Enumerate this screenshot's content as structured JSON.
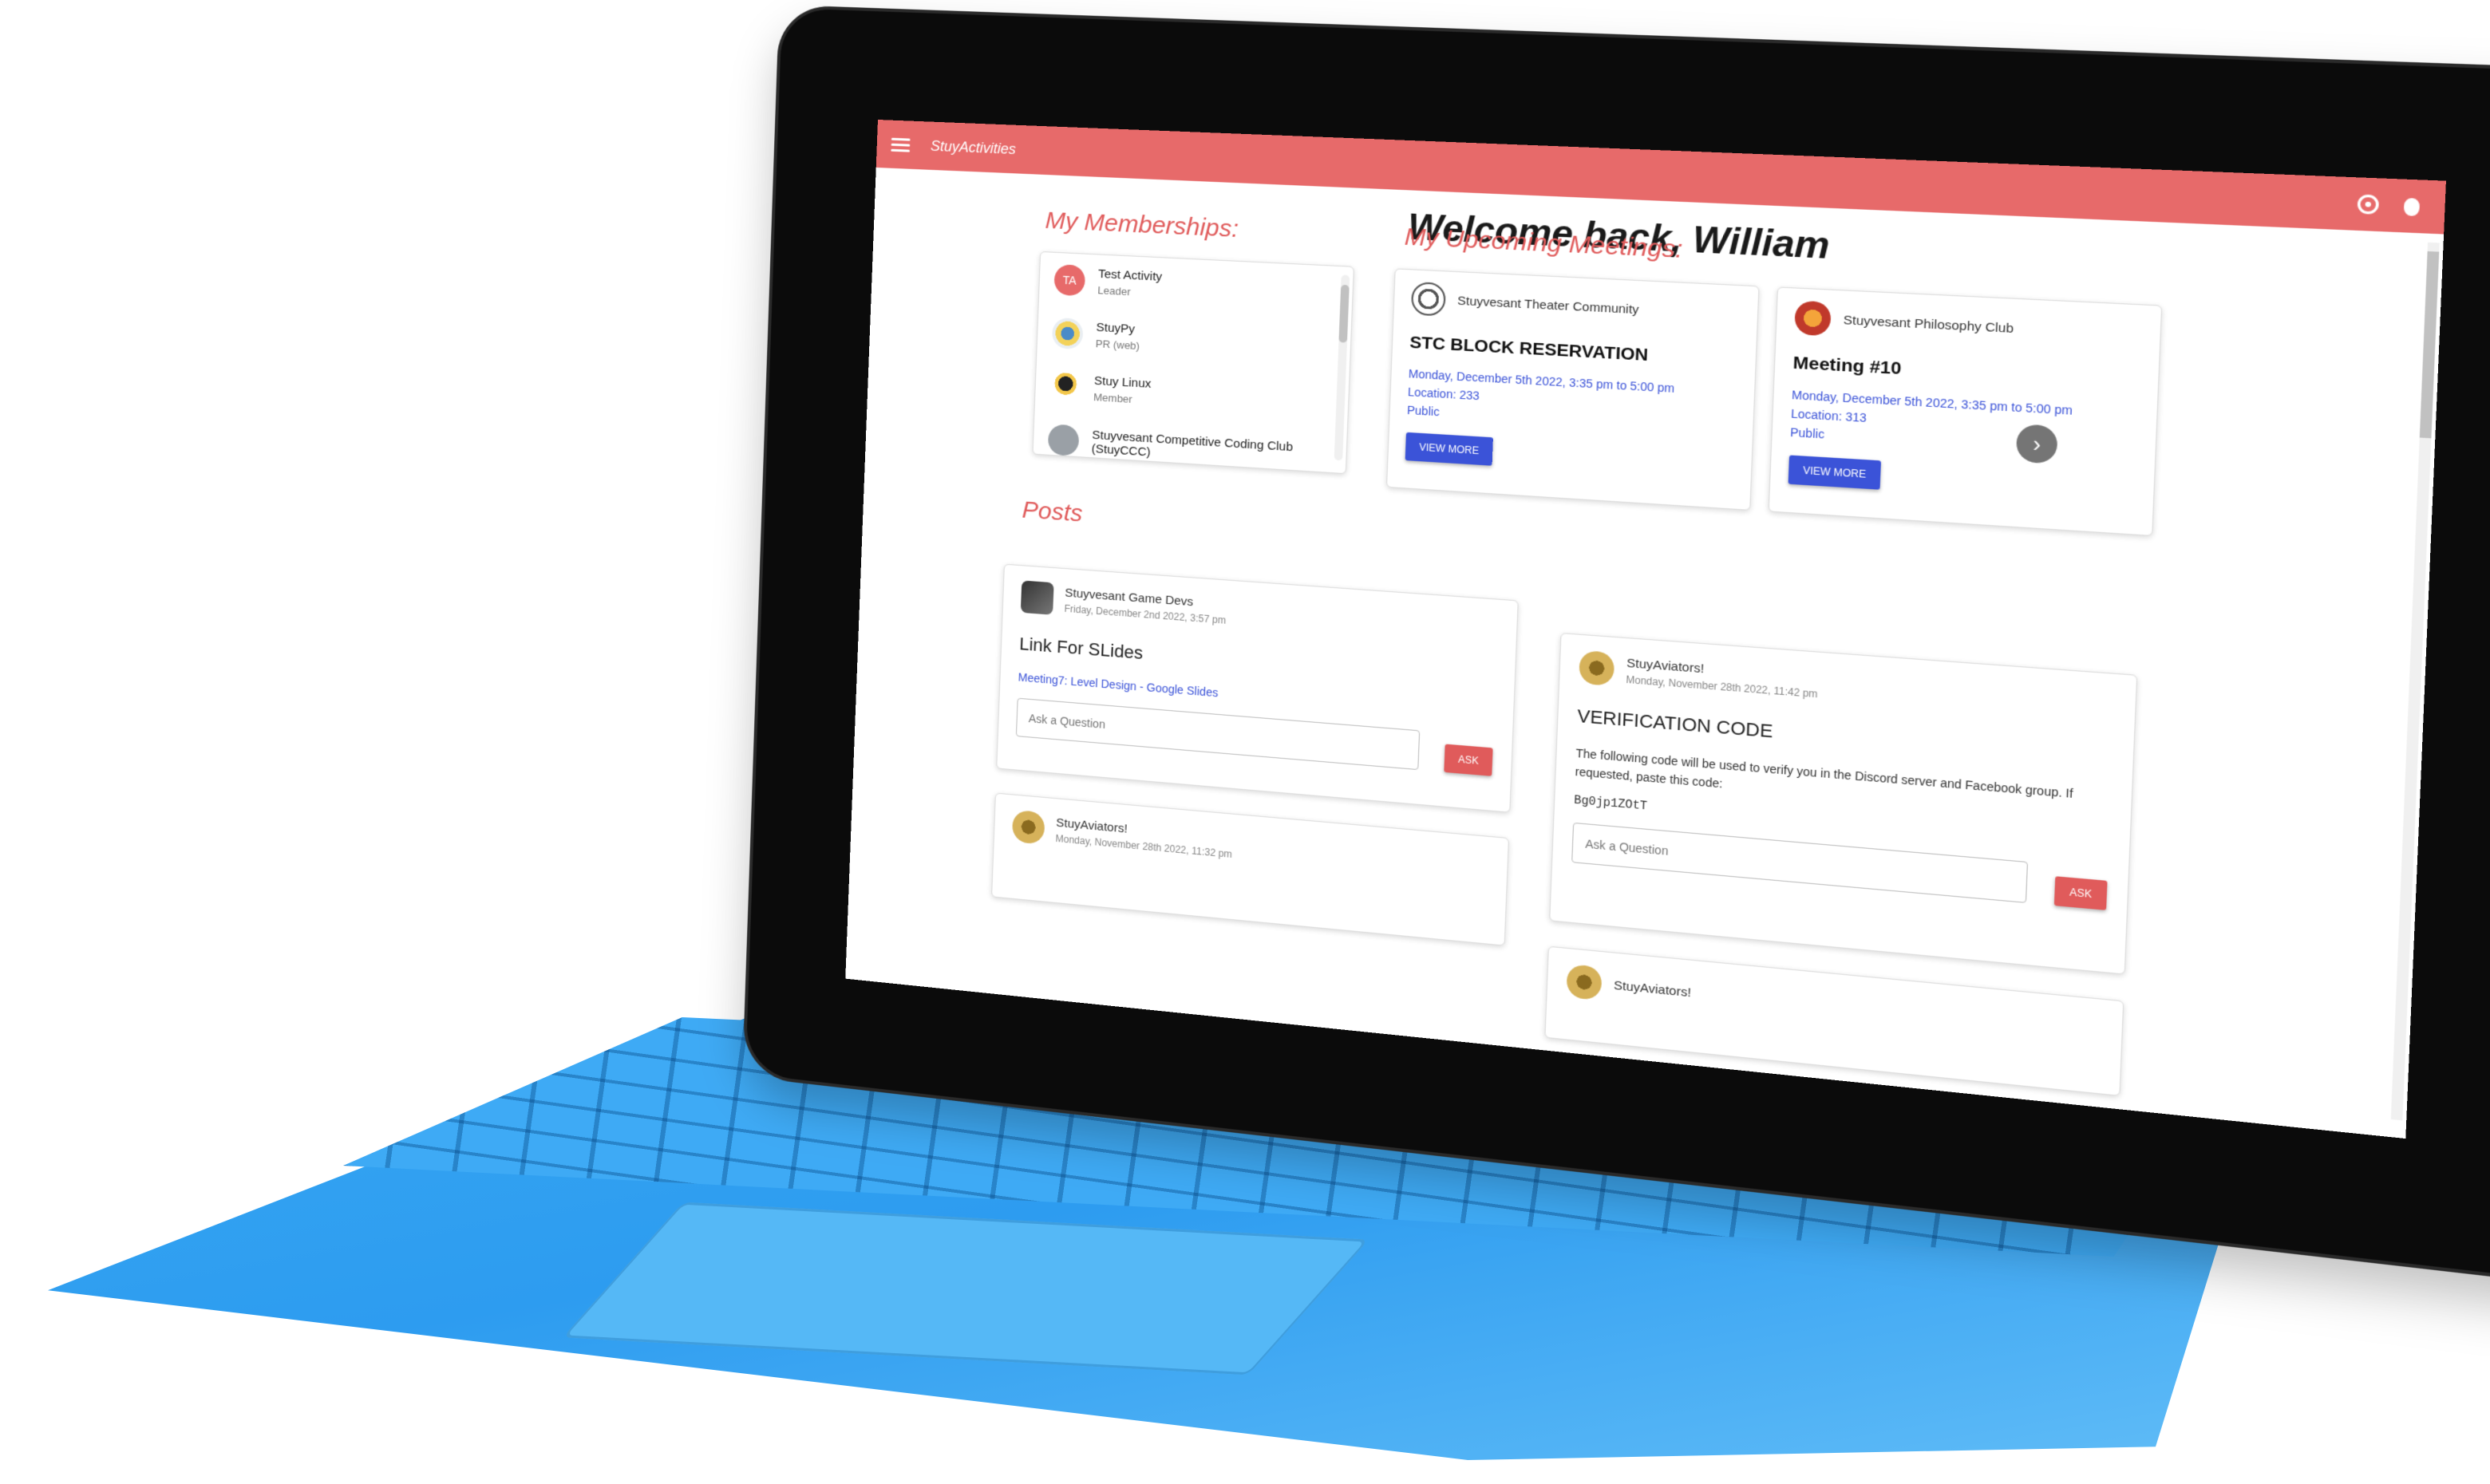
{
  "app": {
    "title": "StuyActivities"
  },
  "welcome": "Welcome back, William",
  "memberships": {
    "title": "My Memberships:",
    "items": [
      {
        "initials": "TA",
        "name": "Test Activity",
        "role": "Leader"
      },
      {
        "initials": "",
        "name": "StuyPy",
        "role": "PR (web)"
      },
      {
        "initials": "",
        "name": "Stuy Linux",
        "role": "Member"
      },
      {
        "initials": "",
        "name": "Stuyvesant Competitive Coding Club (StuyCCC)",
        "role": ""
      }
    ]
  },
  "meetings": {
    "title": "My Upcoming Meetings:",
    "items": [
      {
        "club": "Stuyvesant Theater Community",
        "title": "STC BLOCK RESERVATION",
        "datetime": "Monday, December 5th 2022, 3:35 pm to 5:00 pm",
        "location": "Location: 233",
        "visibility": "Public",
        "button": "VIEW MORE"
      },
      {
        "club": "Stuyvesant Philosophy Club",
        "title": "Meeting #10",
        "datetime": "Monday, December 5th 2022, 3:35 pm to 5:00 pm",
        "location": "Location: 313",
        "visibility": "Public",
        "button": "VIEW MORE"
      }
    ],
    "next_icon": "chevron-right-icon"
  },
  "posts": {
    "title": "Posts",
    "items": [
      {
        "club": "Stuyvesant Game Devs",
        "date": "Friday, December 2nd 2022, 3:57 pm",
        "title": "Link For SLides",
        "link": "Meeting7: Level Design - Google Slides",
        "ask_placeholder": "Ask a Question",
        "ask_button": "ASK"
      },
      {
        "club": "StuyAviators!",
        "date": "Monday, November 28th 2022, 11:42 pm",
        "title": "VERIFICATION CODE",
        "body": "The following code will be used to verify you in the Discord server and Facebook group. If requested, paste this code:",
        "code": "Bg0jp1ZOtT",
        "ask_placeholder": "Ask a Question",
        "ask_button": "ASK"
      },
      {
        "club": "StuyAviators!",
        "date": "Monday, November 28th 2022, 11:32 pm"
      },
      {
        "club": "StuyAviators!"
      }
    ]
  },
  "icons": {
    "menu": "menu-icon",
    "settings": "settings-icon",
    "bug": "bug-icon"
  },
  "colors": {
    "appbar": "#e76a6a",
    "accent_red": "#e05b5b",
    "primary_blue": "#3b53d8",
    "keyboard_blue": "#2d9cf0"
  }
}
